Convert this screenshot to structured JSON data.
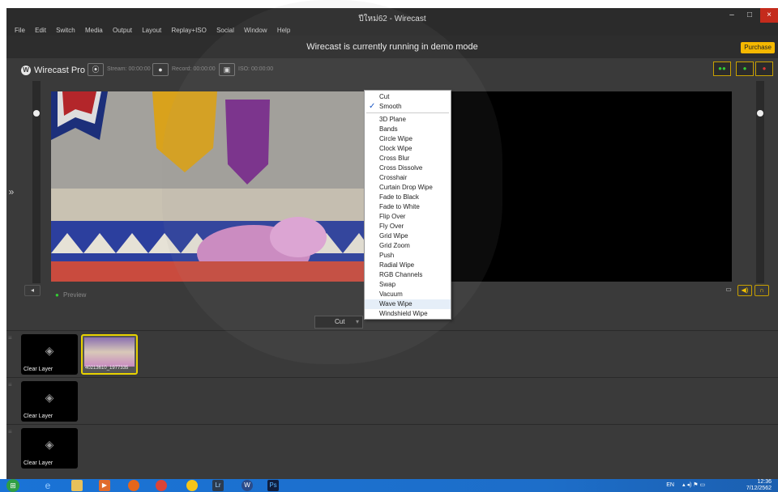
{
  "window": {
    "title": "ปีใหม่62 - Wirecast",
    "controls": [
      "–",
      "□",
      "×"
    ]
  },
  "menu": [
    "File",
    "Edit",
    "Switch",
    "Media",
    "Output",
    "Layout",
    "Replay+ISO",
    "Social",
    "Window",
    "Help"
  ],
  "banner": {
    "message": "Wirecast is currently running in demo mode",
    "purchase_label": "Purchase"
  },
  "toolbar": {
    "brand": "Wirecast Pro",
    "stream_label": "Stream: 00:00:00",
    "record_label": "Record: 00:00:00",
    "iso_label": "ISO: 00:00:00"
  },
  "preview": {
    "label": "Preview"
  },
  "transition": {
    "selected": "Cut",
    "options": [
      "Cut",
      "Smooth",
      "3D Plane",
      "Bands",
      "Circle Wipe",
      "Clock Wipe",
      "Cross Blur",
      "Cross Dissolve",
      "Crosshair",
      "Curtain Drop Wipe",
      "Fade to Black",
      "Fade to White",
      "Flip Over",
      "Fly Over",
      "Grid Wipe",
      "Grid Zoom",
      "Push",
      "Radial Wipe",
      "RGB Channels",
      "Swap",
      "Vacuum",
      "Wave Wipe",
      "Windshield Wipe"
    ],
    "checked": "Smooth",
    "highlighted": "Wave Wipe"
  },
  "layers": [
    {
      "cards": [
        {
          "label": "Clear Layer"
        },
        {
          "label": "40213610_1977335"
        }
      ]
    },
    {
      "cards": [
        {
          "label": "Clear Layer"
        }
      ]
    },
    {
      "cards": [
        {
          "label": "Clear Layer"
        }
      ]
    }
  ],
  "taskbar": {
    "apps": [
      "ie-icon",
      "explorer-icon",
      "media-icon",
      "firefox-icon",
      "chrome-icon",
      "folder-icon",
      "lightroom-icon",
      "wirecast-icon",
      "photoshop-icon"
    ],
    "lang": "EN",
    "time": "12:36",
    "date": "7/12/2562"
  }
}
